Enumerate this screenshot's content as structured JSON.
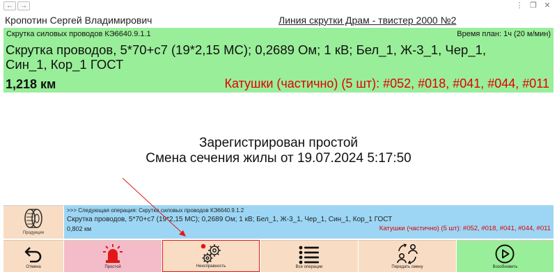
{
  "nav": {
    "back_glyph": "←",
    "forward_glyph": "→"
  },
  "window_controls": {
    "menu": "⋮",
    "restore": "❐",
    "close": "✕"
  },
  "header": {
    "user_name": "Кропотин Сергей Владимирович",
    "line_name": "Линия скрутки Драм - твистер 2000 №2"
  },
  "current_operation": {
    "code_line": "Скрутка силовых проводов КЭ6640.9.1.1",
    "planned_time": "Время план: 1ч (20 м/мин)",
    "title_line1": "Скрутка проводов, 5*70+с7 (19*2,15 МС); 0,2689 Ом; 1 кВ; Бел_1, Ж-3_1, Чер_1,",
    "title_line2": "Син_1, Кор_1 ГОСТ",
    "length": "1,218 км",
    "coils": "Катушки (частично) (5 шт): #052, #018, #041, #044, #011"
  },
  "message": {
    "line1": "Зарегистрирован простой",
    "line2": "Смена сечения жилы от 19.07.2024 5:17:50"
  },
  "products": {
    "label": "Продукция",
    "icon": "cable-reel-icon"
  },
  "next_operation": {
    "header": ">>> Следующая операция: Скрутка силовых проводов КЭ6640.9.1.2",
    "title": "Скрутка проводов, 5*70+с7 (19*2,15 МС); 0,2689 Ом; 1 кВ; Бел_1, Ж-3_1, Чер_1, Син_1, Кор_1 ГОСТ",
    "length": "0,802 км",
    "coils": "Катушки (частично) (5 шт): #052, #018, #041, #044, #011"
  },
  "buttons": {
    "cancel": "Отмена",
    "idle": "Простой",
    "fault": "Неисправность",
    "all_operations": "Все операции",
    "handover_shift": "Передать смену",
    "resume": "Возобновить"
  },
  "colors": {
    "current_panel": "#99ee99",
    "next_panel": "#9cd6f4",
    "coils_text": "#e00000",
    "idle_button": "#f4bcc8",
    "neutral_button": "#f8ddc4",
    "fault_border": "#e01818",
    "annotation_arrow": "#e01818"
  }
}
